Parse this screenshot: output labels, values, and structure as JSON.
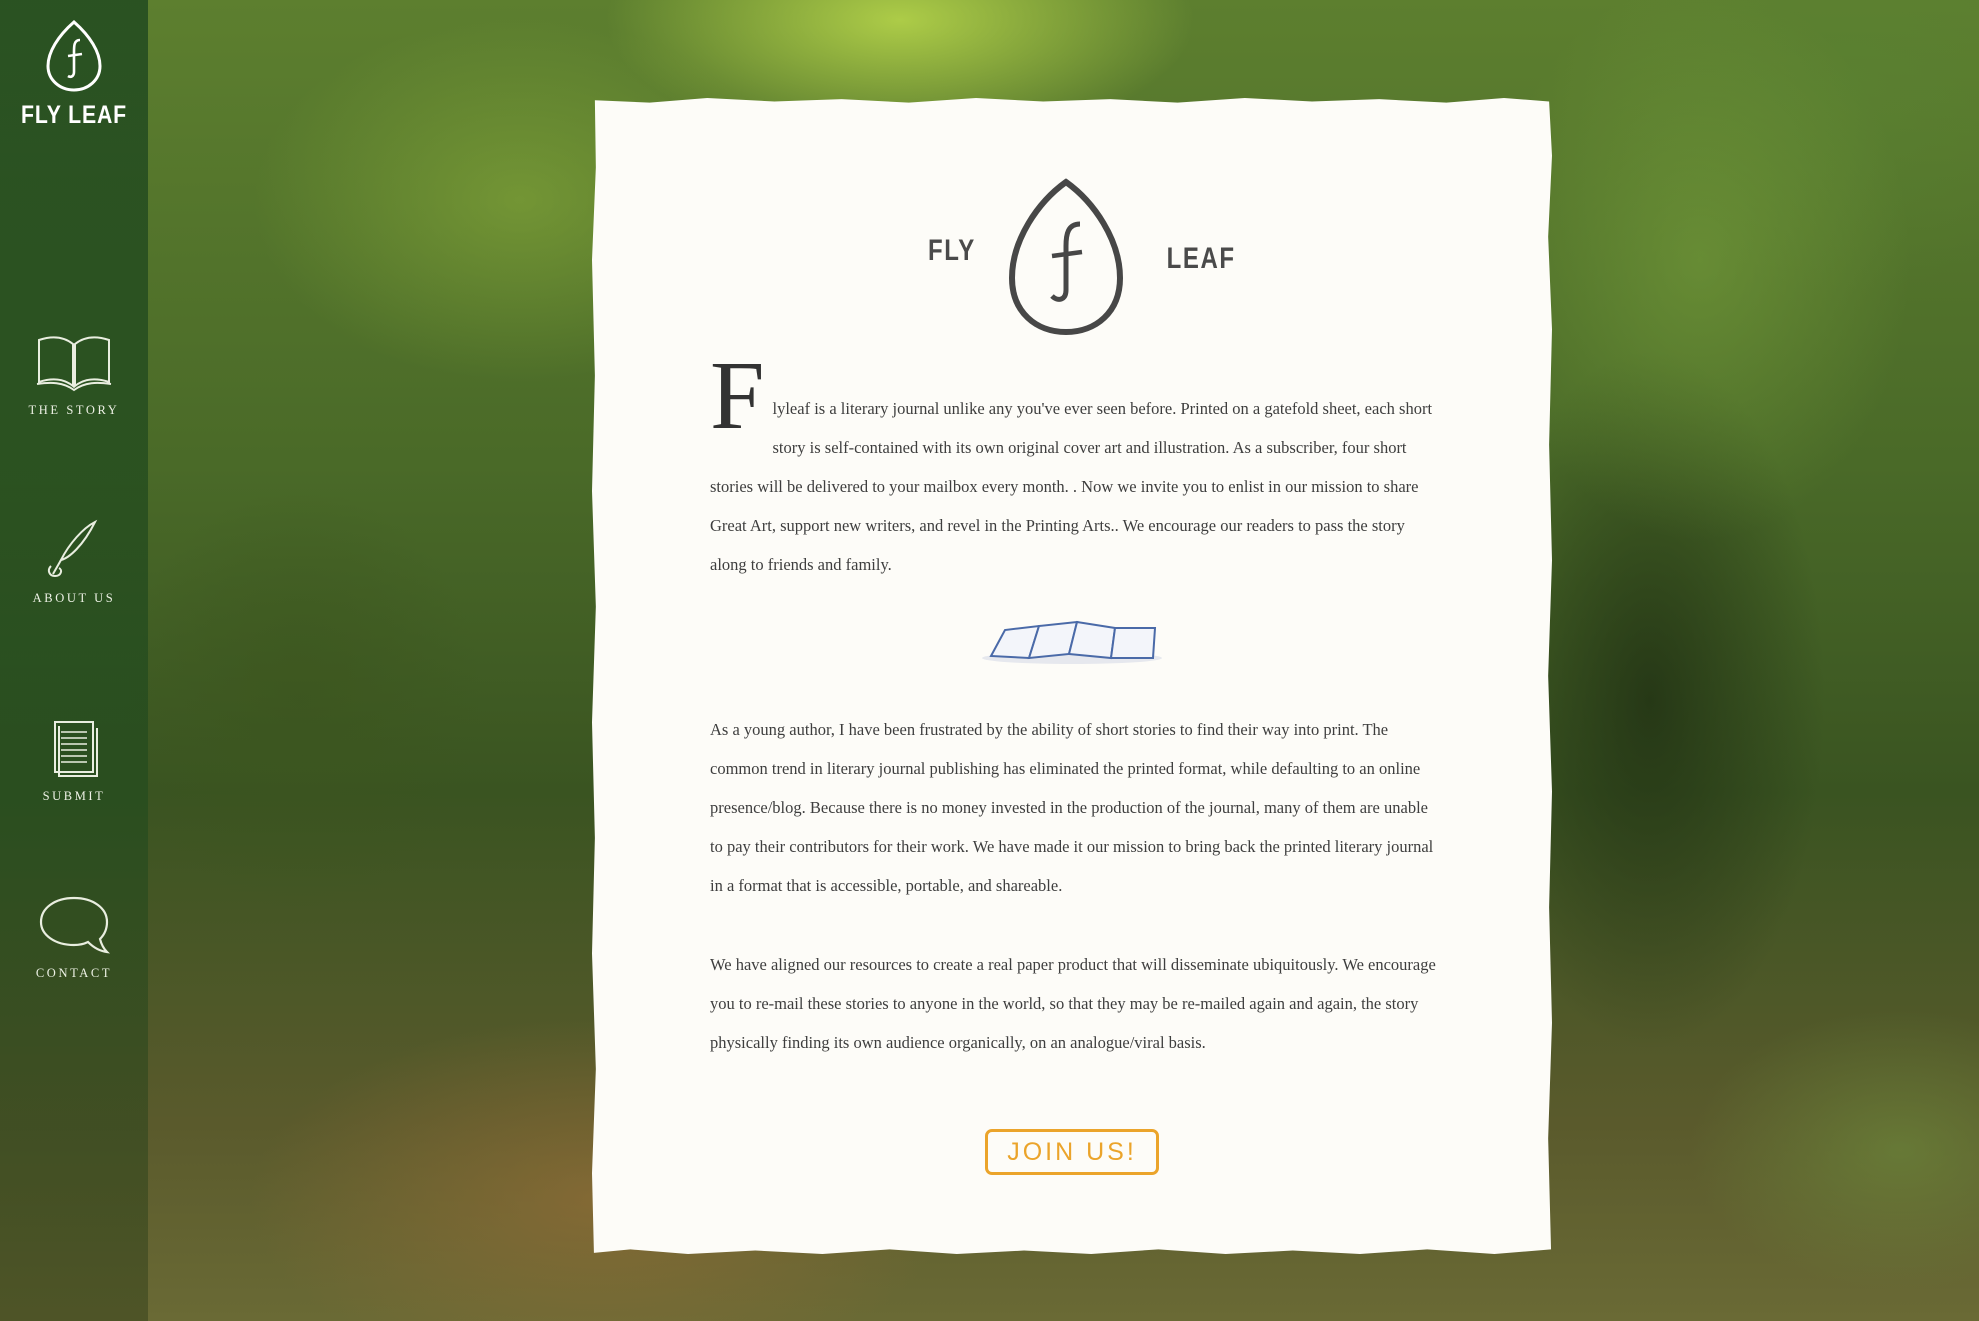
{
  "brand": {
    "name": "FLY LEAF",
    "logo_letter": "F"
  },
  "nav": [
    {
      "label": "THE STORY",
      "icon": "open-book-icon"
    },
    {
      "label": "ABOUT US",
      "icon": "quill-pen-icon"
    },
    {
      "label": "SUBMIT",
      "icon": "document-stack-icon"
    },
    {
      "label": "CONTACT",
      "icon": "speech-bubble-icon"
    }
  ],
  "card": {
    "logo_left": "FLY",
    "logo_right": "LEAF",
    "drop_cap": "F",
    "paragraph1": "lyleaf is a literary journal unlike any you've ever seen before. Printed on a gatefold sheet, each short story is self-contained with its own original cover art and illustration. As a subscriber, four short stories will be delivered to your mailbox every month. . Now we invite you to enlist in our mission to share Great Art, support new writers, and revel in the Printing Arts.. We encourage our readers to pass the story along to friends and family.",
    "paragraph2": "As a young author, I have been frustrated by the ability of short stories to find their way into print. The common trend in literary journal publishing has eliminated the printed format, while defaulting to an online presence/blog. Because there is no money invested in the production of the journal, many of them are unable to pay their contributors for their work. We have made it our mission to bring back the printed literary journal in a format that is accessible, portable, and shareable.",
    "paragraph3": "We have aligned our resources to create a real paper product that will disseminate ubiquitously. We encourage you to re-mail these stories to anyone in the world, so that they may be re-mailed again and again, the story physically finding its own audience organically, on an analogue/viral basis.",
    "join_label": "JOIN US!"
  },
  "colors": {
    "accent": "#eba42b",
    "sidebar": "#1c461e",
    "paper": "#fdfcf8",
    "text": "#3e3e3e"
  }
}
